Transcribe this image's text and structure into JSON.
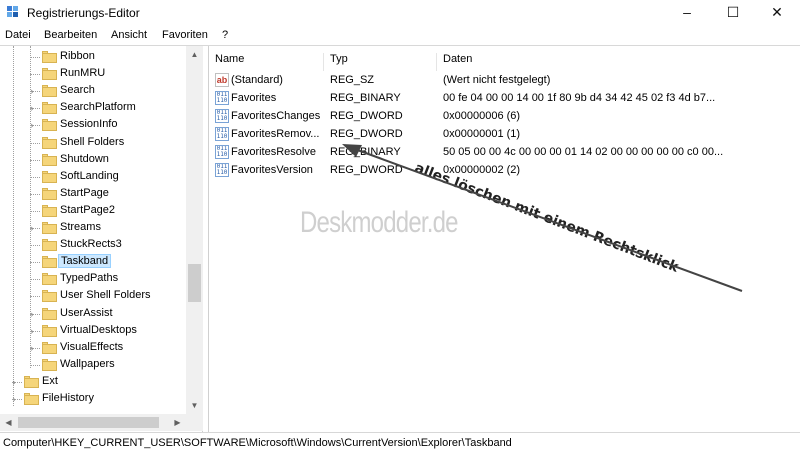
{
  "window": {
    "title": "Registrierungs-Editor",
    "controls": {
      "minimize": "–",
      "maximize": "☐",
      "close": "✕"
    }
  },
  "menu": [
    "Datei",
    "Bearbeiten",
    "Ansicht",
    "Favoriten",
    "?"
  ],
  "tree": {
    "items": [
      {
        "label": "Ribbon",
        "expandable": false
      },
      {
        "label": "RunMRU",
        "expandable": false
      },
      {
        "label": "Search",
        "expandable": true
      },
      {
        "label": "SearchPlatform",
        "expandable": true
      },
      {
        "label": "SessionInfo",
        "expandable": true
      },
      {
        "label": "Shell Folders",
        "expandable": false
      },
      {
        "label": "Shutdown",
        "expandable": false
      },
      {
        "label": "SoftLanding",
        "expandable": false
      },
      {
        "label": "StartPage",
        "expandable": false
      },
      {
        "label": "StartPage2",
        "expandable": false
      },
      {
        "label": "Streams",
        "expandable": true
      },
      {
        "label": "StuckRects3",
        "expandable": false
      },
      {
        "label": "Taskband",
        "expandable": false,
        "selected": true
      },
      {
        "label": "TypedPaths",
        "expandable": false
      },
      {
        "label": "User Shell Folders",
        "expandable": false
      },
      {
        "label": "UserAssist",
        "expandable": true
      },
      {
        "label": "VirtualDesktops",
        "expandable": true
      },
      {
        "label": "VisualEffects",
        "expandable": true
      },
      {
        "label": "Wallpapers",
        "expandable": false
      }
    ],
    "parent_items": [
      {
        "label": "Ext",
        "expandable": true
      },
      {
        "label": "FileHistory",
        "expandable": true
      }
    ]
  },
  "list": {
    "columns": [
      "Name",
      "Typ",
      "Daten"
    ],
    "rows": [
      {
        "icon": "string-value-icon",
        "name": "(Standard)",
        "type": "REG_SZ",
        "data": "(Wert nicht festgelegt)"
      },
      {
        "icon": "binary-value-icon",
        "name": "Favorites",
        "type": "REG_BINARY",
        "data": "00 fe 04 00 00 14 00 1f 80 9b d4 34 42 45 02 f3 4d b7..."
      },
      {
        "icon": "binary-value-icon",
        "name": "FavoritesChanges",
        "type": "REG_DWORD",
        "data": "0x00000006 (6)"
      },
      {
        "icon": "binary-value-icon",
        "name": "FavoritesRemov...",
        "type": "REG_DWORD",
        "data": "0x00000001 (1)"
      },
      {
        "icon": "binary-value-icon",
        "name": "FavoritesResolve",
        "type": "REG_BINARY",
        "data": "50 05 00 00 4c 00 00 00 01 14 02 00 00 00 00 00 c0 00..."
      },
      {
        "icon": "binary-value-icon",
        "name": "FavoritesVersion",
        "type": "REG_DWORD",
        "data": "0x00000002 (2)"
      }
    ]
  },
  "watermark": "Deskmodder.de",
  "annotation": "alles löschen mit einem  Rechtsklick",
  "statusbar": {
    "path": "Computer\\HKEY_CURRENT_USER\\SOFTWARE\\Microsoft\\Windows\\CurrentVersion\\Explorer\\Taskband"
  },
  "colors": {
    "selection": "#cce8ff",
    "folder": "#f5d57a",
    "scrollbar": "#f0f0f0"
  }
}
